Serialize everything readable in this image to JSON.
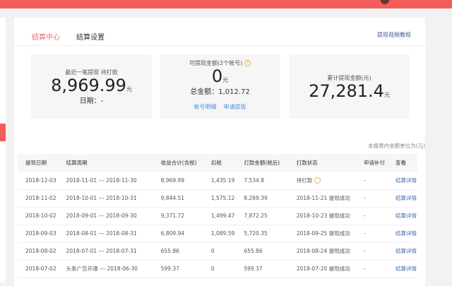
{
  "tabs": [
    "结算中心",
    "结算设置"
  ],
  "tutorial_link": "提现视频教程",
  "recent": {
    "label": "最近一笔提现 待打款",
    "amount": "8,969.99",
    "unit": "元",
    "date_label": "日期：",
    "date": "-"
  },
  "available": {
    "label": "可提现金额(2个帐号)",
    "help": "?",
    "amount": "0",
    "unit": "元",
    "total_label": "总金额：",
    "total": "1,012.72",
    "links": [
      "帐号明细",
      "申请提现"
    ]
  },
  "cumulative": {
    "label": "累计提现金额(元)",
    "amount": "27,281.4",
    "unit": "元"
  },
  "note": "本报表内金额单位为(元)",
  "table": {
    "headers": [
      "提现日期",
      "结算周期",
      "收益合计(含税)",
      "扣税",
      "打款金额(税后)",
      "打款状态",
      "申请补付",
      "查看"
    ],
    "rows": [
      [
        "2018-12-03",
        "2018-11-01 --- 2018-11-30",
        "8,969.99",
        "1,435.19",
        "7,534.8",
        "待打款",
        "-",
        "结算详情"
      ],
      [
        "2018-11-02",
        "2018-10-01 --- 2018-10-31",
        "9,844.51",
        "1,575.12",
        "8,269.39",
        "2018-11-21 提现成功",
        "-",
        "结算详情"
      ],
      [
        "2018-10-02",
        "2018-09-01 --- 2018-09-30",
        "9,371.72",
        "1,499.47",
        "7,872.25",
        "2018-10-23 提现成功",
        "-",
        "结算详情"
      ],
      [
        "2018-09-03",
        "2018-08-01 --- 2018-08-31",
        "6,809.94",
        "1,089.59",
        "5,720.35",
        "2018-09-25 提现成功",
        "-",
        "结算详情"
      ],
      [
        "2018-08-02",
        "2018-07-01 --- 2018-07-31",
        "655.86",
        "0",
        "655.86",
        "2018-08-24 提现成功",
        "-",
        "结算详情"
      ],
      [
        "2018-07-02",
        "头条广告开通 --- 2018-06-30",
        "599.37",
        "0",
        "599.37",
        "2018-07-20 提现成功",
        "-",
        "结算详情"
      ]
    ]
  }
}
